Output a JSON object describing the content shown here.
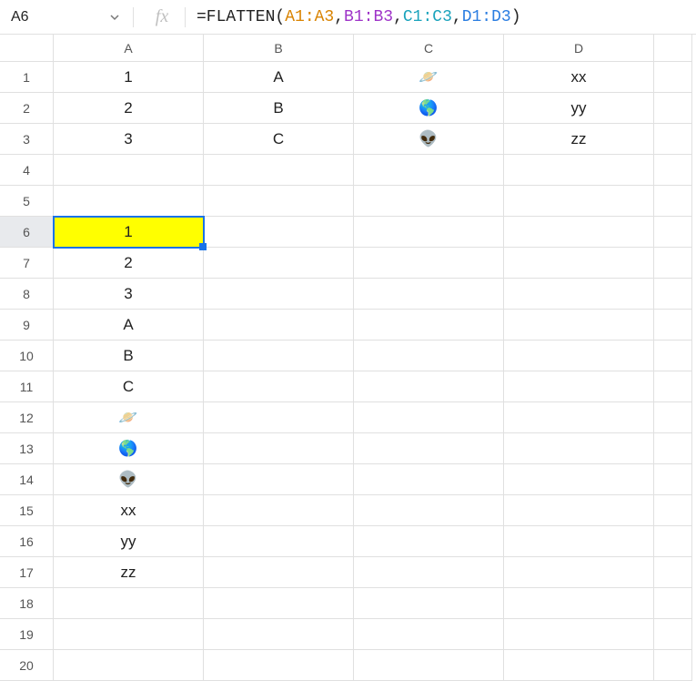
{
  "nameBox": "A6",
  "formula": {
    "prefix": "=FLATTEN(",
    "r1": "A1:A3",
    "r2": "B1:B3",
    "r3": "C1:C3",
    "r4": "D1:D3",
    "sep": ",",
    "suffix": ")"
  },
  "columns": [
    "A",
    "B",
    "C",
    "D"
  ],
  "rows": [
    "1",
    "2",
    "3",
    "4",
    "5",
    "6",
    "7",
    "8",
    "9",
    "10",
    "11",
    "12",
    "13",
    "14",
    "15",
    "16",
    "17",
    "18",
    "19",
    "20"
  ],
  "cells": {
    "A1": "1",
    "B1": "A",
    "C1": "🪐",
    "D1": "xx",
    "A2": "2",
    "B2": "B",
    "C2": "🌎",
    "D2": "yy",
    "A3": "3",
    "B3": "C",
    "C3": "👽",
    "D3": "zz",
    "A6": "1",
    "A7": "2",
    "A8": "3",
    "A9": "A",
    "A10": "B",
    "A11": "C",
    "A12": "🪐",
    "A13": "🌎",
    "A14": "👽",
    "A15": "xx",
    "A16": "yy",
    "A17": "zz"
  },
  "selectedCell": "A6"
}
